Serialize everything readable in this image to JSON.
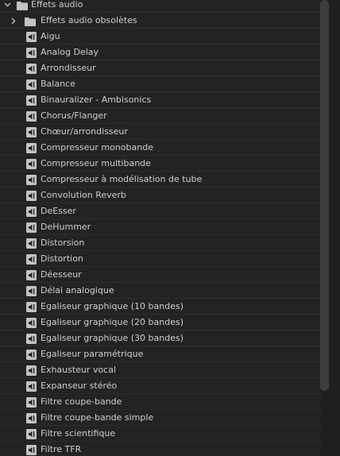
{
  "tree": {
    "root": {
      "label": "Effets audio",
      "expanded": true,
      "icon": "folder-icon"
    },
    "subfolder": {
      "label": "Effets audio obsolètes",
      "expanded": false,
      "icon": "folder-icon"
    },
    "items": [
      "Aigu",
      "Analog Delay",
      "Arrondisseur",
      "Balance",
      "Binauralizer - Ambisonics",
      "Chorus/Flanger",
      "Chœur/arrondisseur",
      "Compresseur monobande",
      "Compresseur multibande",
      "Compresseur à modélisation de tube",
      "Convolution Reverb",
      "DeEsser",
      "DeHummer",
      "Distorsion",
      "Distortion",
      "Déesseur",
      "Délai analogique",
      "Egaliseur graphique (10 bandes)",
      "Egaliseur graphique (20 bandes)",
      "Egaliseur graphique (30 bandes)",
      "Egaliseur paramétrique",
      "Exhausteur vocal",
      "Expanseur stéréo",
      "Filtre coupe-bande",
      "Filtre coupe-bande simple",
      "Filtre scientifique",
      "Filtre TFR"
    ],
    "item_icon": "audio-effect-icon"
  },
  "colors": {
    "background": "#232323",
    "row_divider": "#2d2d2d",
    "text": "#cfcfcf",
    "icon": "#c4c4c4",
    "scroll_thumb": "#3c3c3c"
  }
}
